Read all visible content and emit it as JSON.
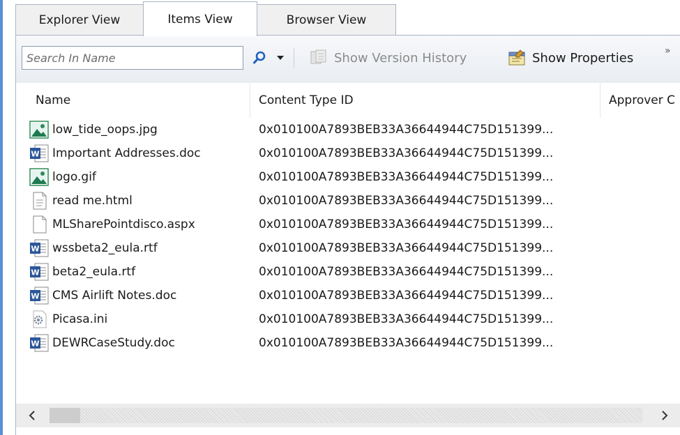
{
  "tabs": [
    {
      "label": "Explorer View"
    },
    {
      "label": "Items View"
    },
    {
      "label": "Browser View"
    }
  ],
  "toolbar": {
    "search_placeholder": "Search In Name",
    "show_version_history": "Show Version History",
    "show_properties": "Show Properties",
    "overflow": "»"
  },
  "columns": [
    {
      "label": "Name"
    },
    {
      "label": "Content Type ID"
    },
    {
      "label": "Approver C"
    }
  ],
  "rows": [
    {
      "name": "low_tide_oops.jpg",
      "icon": "image-file-icon",
      "content_type_id": "0x010100A7893BEB33A36644944C75D151399..."
    },
    {
      "name": "Important Addresses.doc",
      "icon": "word-doc-icon",
      "content_type_id": "0x010100A7893BEB33A36644944C75D151399..."
    },
    {
      "name": "logo.gif",
      "icon": "image-file-icon",
      "content_type_id": "0x010100A7893BEB33A36644944C75D151399..."
    },
    {
      "name": "read me.html",
      "icon": "text-file-icon",
      "content_type_id": "0x010100A7893BEB33A36644944C75D151399..."
    },
    {
      "name": "MLSharePointdisco.aspx",
      "icon": "blank-file-icon",
      "content_type_id": "0x010100A7893BEB33A36644944C75D151399..."
    },
    {
      "name": "wssbeta2_eula.rtf",
      "icon": "word-doc-icon",
      "content_type_id": "0x010100A7893BEB33A36644944C75D151399..."
    },
    {
      "name": "beta2_eula.rtf",
      "icon": "word-doc-icon",
      "content_type_id": "0x010100A7893BEB33A36644944C75D151399..."
    },
    {
      "name": "CMS Airlift Notes.doc",
      "icon": "word-doc-icon",
      "content_type_id": "0x010100A7893BEB33A36644944C75D151399..."
    },
    {
      "name": "Picasa.ini",
      "icon": "settings-file-icon",
      "content_type_id": "0x010100A7893BEB33A36644944C75D151399..."
    },
    {
      "name": "DEWRCaseStudy.doc",
      "icon": "word-doc-icon",
      "content_type_id": "0x010100A7893BEB33A36644944C75D151399..."
    }
  ],
  "colors": {
    "tab_border": "#a9b4c4",
    "word_blue": "#2b579a",
    "image_green": "#2e8b57",
    "search_blue": "#1f5fbf"
  }
}
